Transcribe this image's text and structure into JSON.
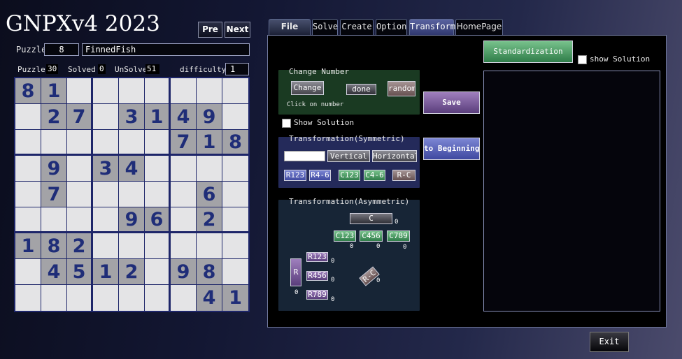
{
  "app": {
    "title": "GNPXv4 2023"
  },
  "nav": {
    "pre": "Pre",
    "next": "Next"
  },
  "puzzle": {
    "label": "Puzzle",
    "number": "8",
    "name": "FinnedFish"
  },
  "stats": {
    "puzzle_label": "Puzzle",
    "puzzle_count": "30",
    "solved_label": "Solved",
    "solved_count": "0",
    "unsolve_label": "UnSolve",
    "unsolve_count": "51",
    "difficulty_label": "difficulty",
    "difficulty_value": "1"
  },
  "grid": [
    "81.......",
    ".27.3149.",
    "......718",
    ".9.34....",
    ".7.....6.",
    "....96.2.",
    "182......",
    ".4512.98.",
    ".......41"
  ],
  "tabs": [
    "File",
    "Solve",
    "Create",
    "Option",
    "Transform",
    "HomePage"
  ],
  "active_tab": "Transform",
  "transform": {
    "standardization": "Standardization",
    "show_solution_top": "show Solution",
    "change_number": {
      "title": "Change Number",
      "change": "Change",
      "done": "done",
      "random": "random",
      "hint": "Click on number"
    },
    "save": "Save",
    "show_solution": "Show Solution",
    "to_beginning": "to Beginning",
    "symmetric": {
      "title": "Transformation(Symmetric)",
      "vertical": "Vertical",
      "horizontal": "Horizontal",
      "r123": "R123",
      "r46": "R4-6",
      "c123": "C123",
      "c46": "C4-6",
      "rc": "R-C"
    },
    "asymmetric": {
      "title": "Transformation(Asymmetric)",
      "c": "C",
      "c123": "C123",
      "c456": "C456",
      "c789": "C789",
      "r": "R",
      "r123": "R123",
      "r456": "R456",
      "r789": "R789",
      "rc": "R-C",
      "c_count": "0",
      "c123_count": "0",
      "c456_count": "0",
      "c789_count": "0",
      "r_count": "0",
      "r123_count": "0",
      "r456_count": "0",
      "r789_count": "0",
      "rc_count": "0"
    }
  },
  "exit": "Exit",
  "colors": {
    "given_cell": "#a3a3a7",
    "digit": "#1f2d78",
    "grid_line": "#1d2569"
  }
}
